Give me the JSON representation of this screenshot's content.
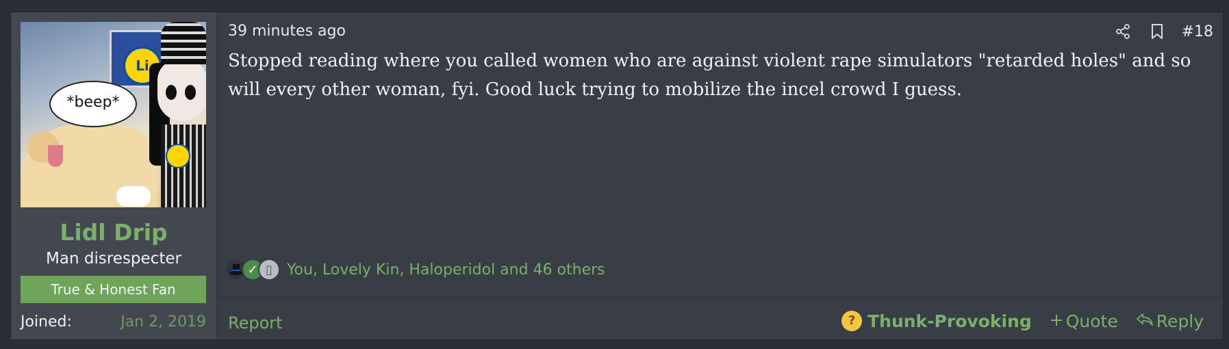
{
  "user": {
    "name": "Lidl Drip",
    "title": "Man disrespecter",
    "banner": "True & Honest Fan",
    "joined_label": "Joined:",
    "joined_date": "Jan 2, 2019",
    "avatar": {
      "bubble_text": "*beep*",
      "logo_text": "Li"
    }
  },
  "post": {
    "time": "39 minutes ago",
    "number": "#18",
    "message": "Stopped reading where you called women who are against violent rape simulators \"retarded holes\" and so will every other woman, fyi. Good luck trying to mobilize the incel crowd I guess.",
    "reactions_text": "You, Lovely Kin, Haloperidol and 46 others",
    "report_label": "Report",
    "reaction_label": "Thunk-Provoking",
    "quote_label": "Quote",
    "reply_label": "Reply"
  },
  "icons": {
    "share": "share-icon",
    "bookmark": "bookmark-icon",
    "quote": "plus-icon",
    "reply": "reply-icon",
    "reaction": "thinking-face-icon"
  },
  "colors": {
    "accent": "#7bb06a",
    "banner": "#6ea55a",
    "background": "#393d45",
    "sidebar": "#43474f"
  }
}
